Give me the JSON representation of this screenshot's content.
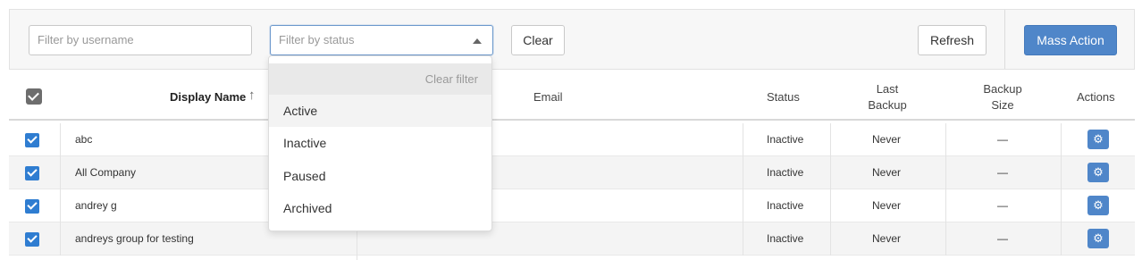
{
  "toolbar": {
    "username_placeholder": "Filter by username",
    "status_placeholder": "Filter by status",
    "clear_label": "Clear",
    "refresh_label": "Refresh",
    "mass_action_label": "Mass Action"
  },
  "status_dropdown": {
    "clear_filter": "Clear filter",
    "options": [
      "Active",
      "Inactive",
      "Paused",
      "Archived"
    ],
    "highlighted": "Active"
  },
  "table": {
    "headers": {
      "display_name": "Display Name",
      "email": "Email",
      "status": "Status",
      "last_backup": "Last Backup",
      "backup_size": "Backup Size",
      "actions": "Actions"
    },
    "sort": "ascending",
    "rows": [
      {
        "checked": true,
        "name": "abc",
        "email": "",
        "status": "Inactive",
        "last_backup": "Never",
        "size": "—"
      },
      {
        "checked": true,
        "name": "All Company",
        "email": "",
        "status": "Inactive",
        "last_backup": "Never",
        "size": "—"
      },
      {
        "checked": true,
        "name": "andrey g",
        "email": "",
        "status": "Inactive",
        "last_backup": "Never",
        "size": "—"
      },
      {
        "checked": true,
        "name": "andreys group for testing",
        "email": "",
        "status": "Inactive",
        "last_backup": "Never",
        "size": "—"
      }
    ]
  },
  "colors": {
    "primary": "#4f86c9",
    "checkbox": "#2f7dd1"
  }
}
